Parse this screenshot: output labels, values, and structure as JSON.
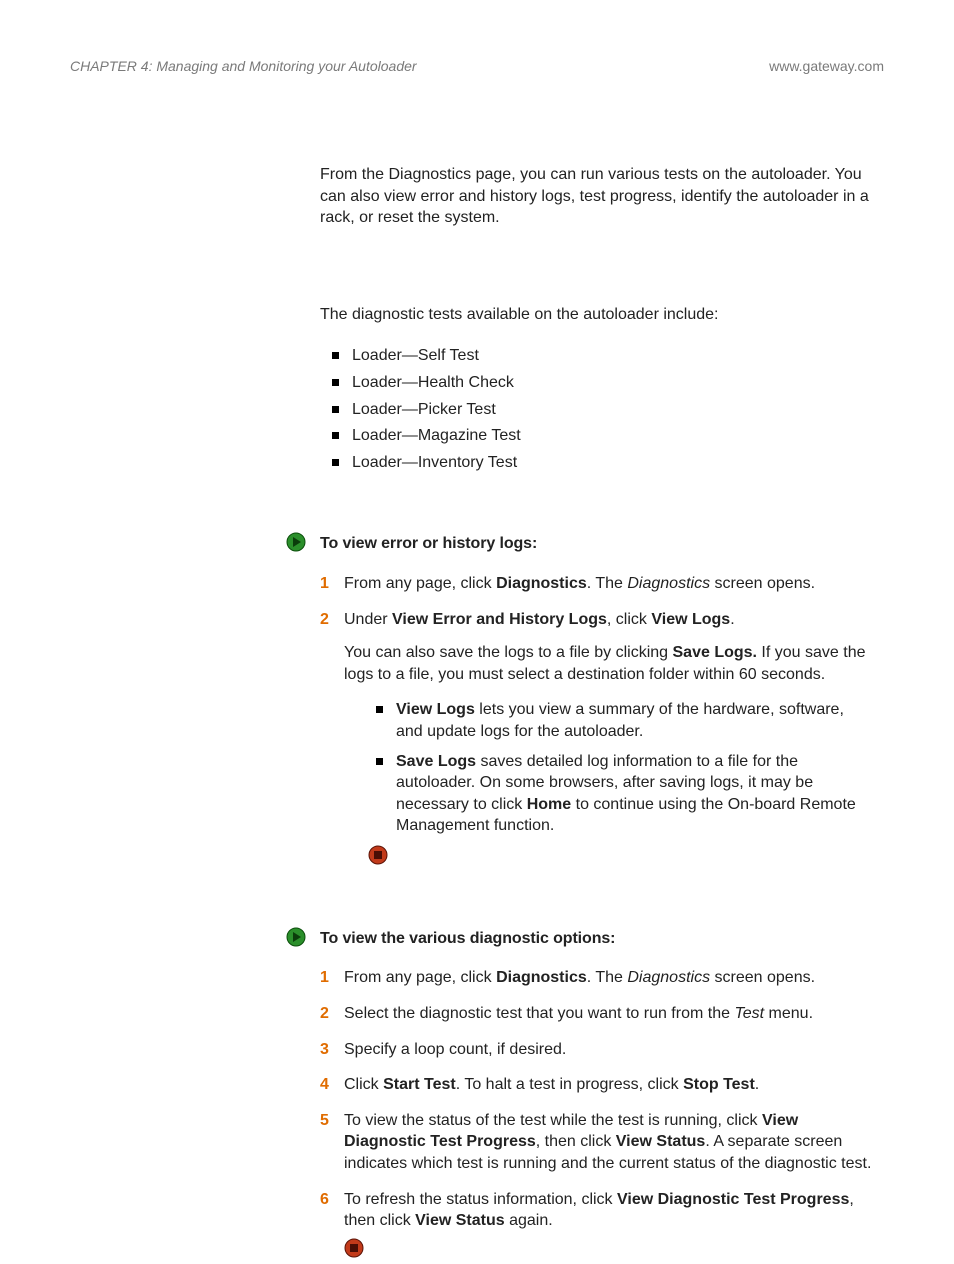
{
  "header": {
    "chapter": "CHAPTER 4: Managing and Monitoring your Autoloader",
    "url": "www.gateway.com"
  },
  "intro": "From the Diagnostics page, you can run various tests on the autoloader. You can also view error and history logs, test progress, identify the autoloader in a rack, or reset the system.",
  "tests_intro": "The diagnostic tests available on the autoloader include:",
  "tests": [
    "Loader—Self Test",
    "Loader—Health Check",
    "Loader—Picker Test",
    "Loader—Magazine Test",
    "Loader—Inventory Test"
  ],
  "proc1": {
    "title": "To view error or history logs:",
    "s1": {
      "pre": "From any page, click ",
      "b1": "Diagnostics",
      "mid": ". The ",
      "i1": "Diagnostics",
      "post": " screen opens."
    },
    "s2": {
      "pre": "Under ",
      "b1": "View Error and History Logs",
      "mid": ", click ",
      "b2": "View Logs",
      "post": "."
    },
    "s2_sub": {
      "pre": "You can also save the logs to a file by clicking ",
      "b1": "Save Logs.",
      "post": " If you save the logs to a file, you must select a destination folder within 60 seconds."
    },
    "sub1": {
      "b": "View Logs",
      "rest": " lets you view a summary of the hardware, software, and update logs for the autoloader."
    },
    "sub2": {
      "b1": "Save Logs",
      "mid": " saves detailed log information to a file for the autoloader. On some browsers, after saving logs, it may be necessary to click ",
      "b2": "Home",
      "post": " to continue using the On-board Remote Management function."
    }
  },
  "proc2": {
    "title": "To view the various diagnostic options:",
    "s1": {
      "pre": "From any page, click ",
      "b1": "Diagnostics",
      "mid": ". The ",
      "i1": "Diagnostics",
      "post": " screen opens."
    },
    "s2": {
      "pre": "Select the diagnostic test that you want to run from the ",
      "i1": "Test",
      "post": " menu."
    },
    "s3": "Specify a loop count, if desired.",
    "s4": {
      "pre": "Click ",
      "b1": "Start Test",
      "mid": ". To halt a test in progress, click ",
      "b2": "Stop Test",
      "post": "."
    },
    "s5": {
      "pre": "To view the status of the test while the test is running, click ",
      "b1": "View Diagnostic Test Progress",
      "mid": ", then click ",
      "b2": "View Status",
      "post": ". A separate screen indicates which test is running and the current status of the diagnostic test."
    },
    "s6": {
      "pre": "To refresh the status information, click ",
      "b1": "View Diagnostic Test Progress",
      "mid": ", then click ",
      "b2": "View Status",
      "post": " again."
    }
  }
}
